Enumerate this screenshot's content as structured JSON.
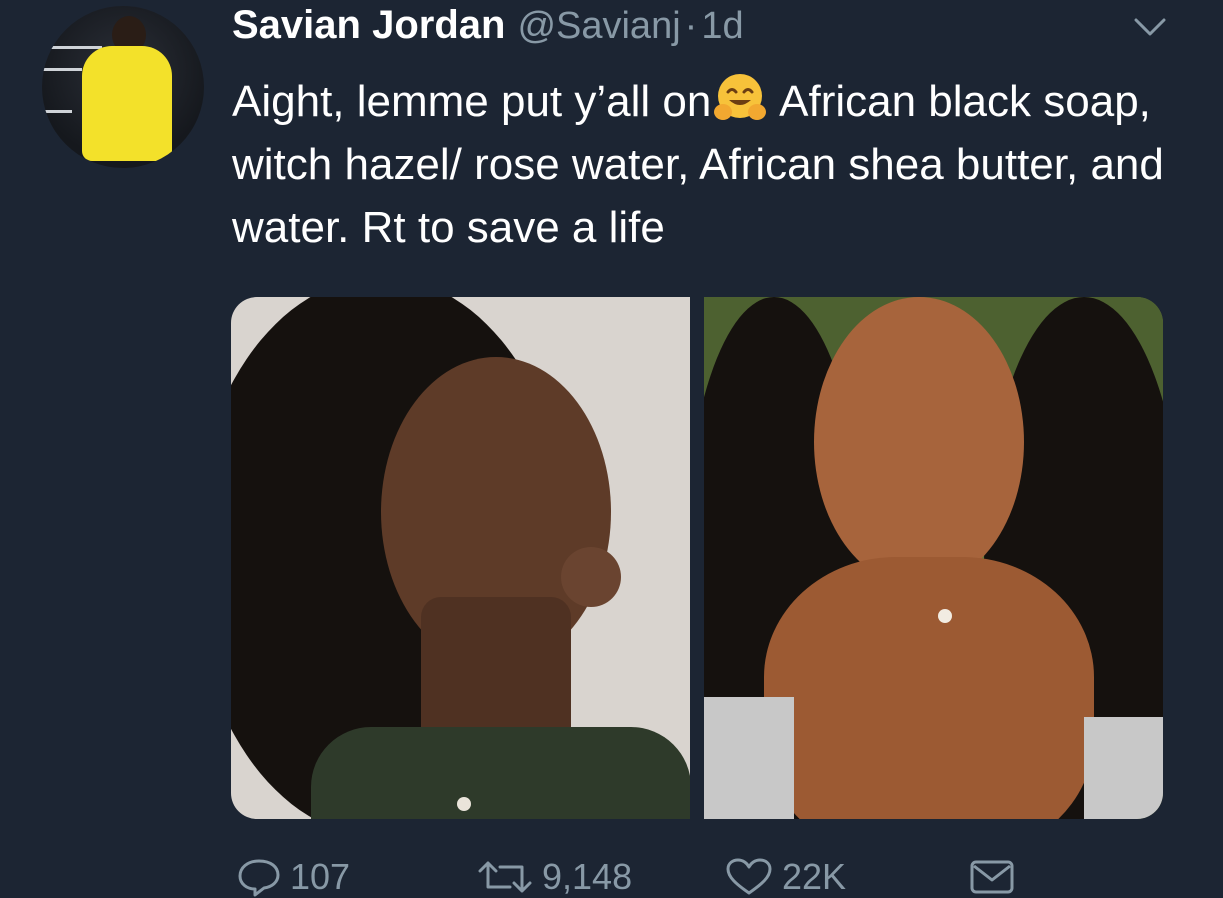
{
  "tweet": {
    "author_name": "Savian Jordan",
    "author_handle": "@Savianj",
    "separator": "·",
    "timestamp": "1d",
    "text_before_emoji": "Aight, lemme put y’all on",
    "emoji_name": "hugging-face-emoji",
    "text_after_emoji": " African black soap, witch hazel/ rose water, African shea butter, and water. Rt to save a life"
  },
  "actions": {
    "replies": "107",
    "retweets": "9,148",
    "likes": "22K"
  },
  "colors": {
    "background": "#1c2533",
    "primary_text": "#ffffff",
    "secondary_text": "#8899a6"
  }
}
